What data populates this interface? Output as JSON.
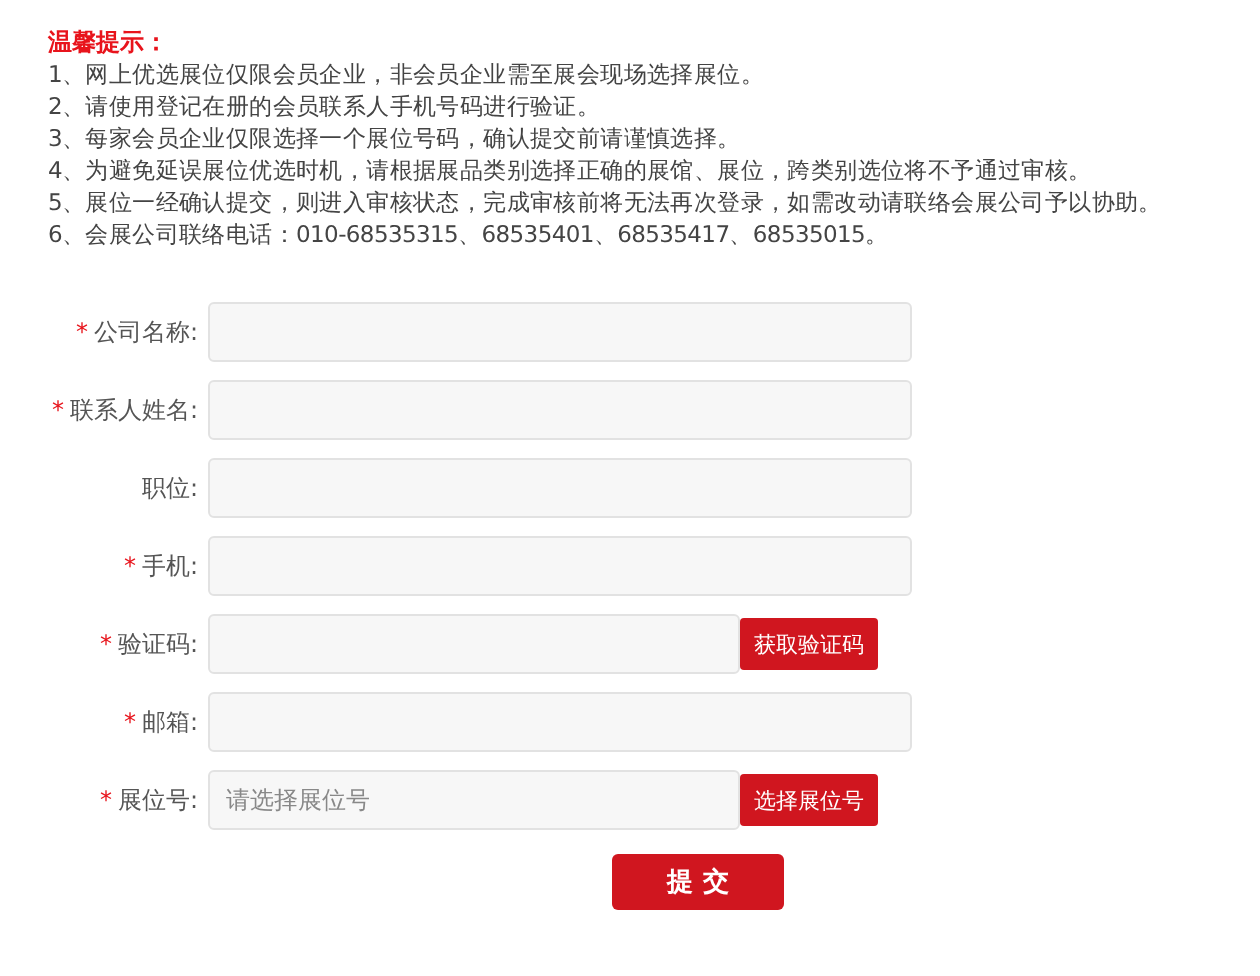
{
  "notice": {
    "title": "温馨提示：",
    "items": [
      "1、网上优选展位仅限会员企业，非会员企业需至展会现场选择展位。",
      "2、请使用登记在册的会员联系人手机号码进行验证。",
      "3、每家会员企业仅限选择一个展位号码，确认提交前请谨慎选择。",
      "4、为避免延误展位优选时机，请根据展品类别选择正确的展馆、展位，跨类别选位将不予通过审核。",
      "5、展位一经确认提交，则进入审核状态，完成审核前将无法再次登录，如需改动请联络会展公司予以协助。",
      "6、会展公司联络电话：010-68535315、68535401、68535417、68535015。"
    ]
  },
  "form": {
    "fields": [
      {
        "marker": "*",
        "label": "公司名称:"
      },
      {
        "marker": "*",
        "label": "联系人姓名:"
      },
      {
        "label": "职位:"
      },
      {
        "marker": "*",
        "label": "手机:"
      },
      {
        "marker": "*",
        "label": "验证码:",
        "button": "获取验证码"
      },
      {
        "marker": "*",
        "label": "邮箱:"
      },
      {
        "marker": "*",
        "label": "展位号:",
        "placeholder": "请选择展位号",
        "button": "选择展位号"
      }
    ],
    "submit": "提 交"
  }
}
